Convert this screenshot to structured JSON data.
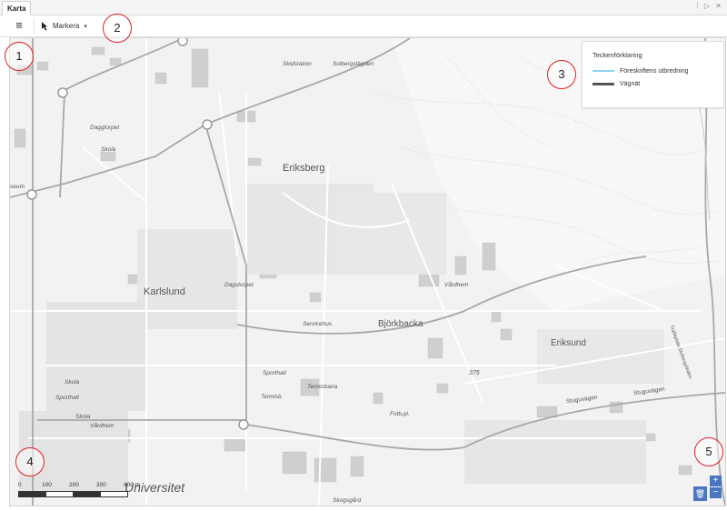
{
  "window": {
    "tab_title": "Karta",
    "controls": "⁞ ▷ ✕"
  },
  "toolbar": {
    "menu_icon": "≡",
    "select_tool_label": "Markera",
    "select_icon": "cursor-arrow",
    "dropdown_icon": "▾"
  },
  "legend": {
    "title": "Teckenförklaring",
    "items": [
      {
        "label": "Föreskriftens utbredning",
        "color": "#8fd3f0"
      },
      {
        "label": "Vägnät",
        "color": "#555555"
      }
    ]
  },
  "map_labels": {
    "eriksberg": "Eriksberg",
    "karlslund": "Karlslund",
    "bjorkbacka": "Björkbacka",
    "eriksund": "Eriksund",
    "skidstation": "Skidstation",
    "solbergslagden": "Solbergslägden",
    "daggtorpet": "Daggtorpet",
    "skola1": "Skola",
    "skola2": "Skola",
    "skola3": "Skola",
    "vardhem1": "Vårdhem",
    "vardhem2": "Vårdhem",
    "servicehus": "Servicehus",
    "sporthall1": "Sporthall",
    "sporthall2": "Sporthall",
    "tennisbana": "Tennisbana",
    "tennis": "Tennisb.",
    "fotb": "Fotb.pl.",
    "elev375": "375",
    "stuguvagen1": "Stuguvägen",
    "stuguvagen2": "Stuguvägen",
    "universitet": "Universitet",
    "dagstorpet": "Dagstorpet",
    "museum": "seum",
    "kyrkogard": "Skogsgård",
    "trafikplats": "Trafikplats Stobergsleden"
  },
  "scalebar": {
    "ticks": [
      "0",
      "100",
      "200",
      "300",
      "400 m"
    ]
  },
  "callouts": [
    "1",
    "2",
    "3",
    "4",
    "5"
  ],
  "zoom": {
    "in": "+",
    "out": "−",
    "trash_icon": "🗑"
  },
  "colors": {
    "accent": "#4a76c0",
    "callout": "#e02020",
    "map_bg": "#f2f2f2"
  }
}
